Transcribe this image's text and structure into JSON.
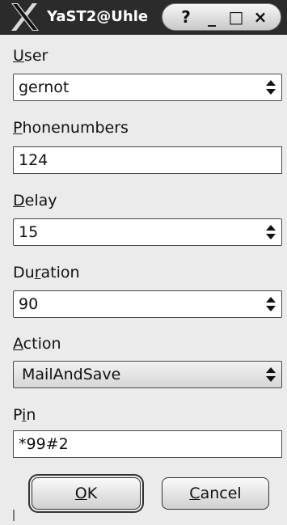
{
  "window": {
    "title": "YaST2@Uhle",
    "buttons": {
      "help": "?",
      "minimize": "_",
      "maximize": "□",
      "close": "×"
    }
  },
  "fields": {
    "user": {
      "label_key": "U",
      "label_rest": "ser",
      "value": "gernot"
    },
    "phonenumbers": {
      "label_key": "P",
      "label_rest": "honenumbers",
      "value": "124"
    },
    "delay": {
      "label_key": "D",
      "label_rest": "elay",
      "value": "15"
    },
    "duration": {
      "label_pre": "Du",
      "label_key": "r",
      "label_rest": "ation",
      "value": "90"
    },
    "action": {
      "label_key": "A",
      "label_rest": "ction",
      "value": "MailAndSave"
    },
    "pin": {
      "label_pre": "P",
      "label_key": "i",
      "label_rest": "n",
      "value": "*99#2"
    }
  },
  "buttons": {
    "ok": {
      "key": "O",
      "rest": "K"
    },
    "cancel": {
      "key": "C",
      "rest": "ancel"
    }
  }
}
